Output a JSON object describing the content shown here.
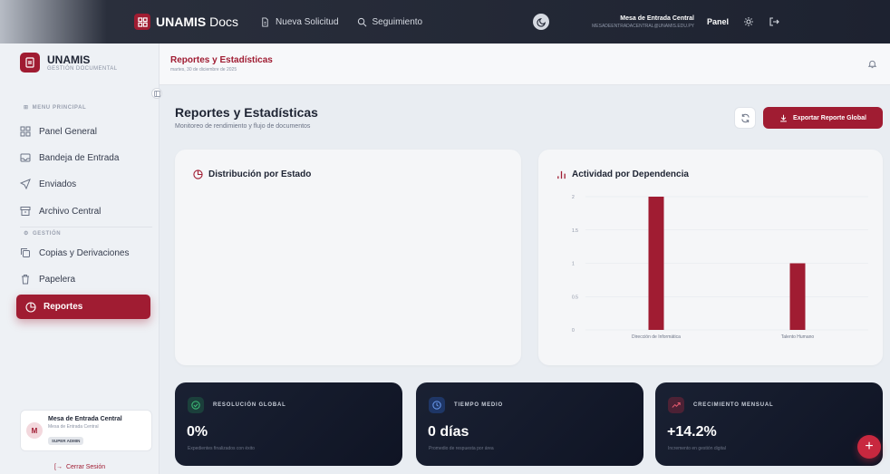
{
  "topbar": {
    "brand_prefix": "UNAMIS",
    "brand_suffix": " Docs",
    "nav": [
      {
        "label": "Nueva Solicitud",
        "icon": "file-icon"
      },
      {
        "label": "Seguimiento",
        "icon": "search-icon"
      }
    ],
    "user_name": "Mesa de Entrada Central",
    "user_email": "MESADEENTRADACENTRAL@UNAMIS.EDU.PY",
    "panel_label": "Panel"
  },
  "sidebar": {
    "brand_title": "UNAMIS",
    "brand_sub": "GESTIÓN DOCUMENTAL",
    "section_main": "MENU PRINCIPAL",
    "section_mgmt": "GESTIÓN",
    "items": [
      {
        "label": "Panel General",
        "icon": "grid-icon"
      },
      {
        "label": "Bandeja de Entrada",
        "icon": "inbox-icon"
      },
      {
        "label": "Enviados",
        "icon": "send-icon"
      },
      {
        "label": "Archivo Central",
        "icon": "archive-icon"
      },
      {
        "label": "Copias y Derivaciones",
        "icon": "copy-icon"
      },
      {
        "label": "Papelera",
        "icon": "trash-icon"
      },
      {
        "label": "Reportes",
        "icon": "pie-chart-icon",
        "active": true
      }
    ],
    "user": {
      "initial": "M",
      "name": "Mesa de Entrada Central",
      "role": "Mesa de Entrada Central",
      "badge": "SUPER ADMIN"
    },
    "logout": "Cerrar Sesión"
  },
  "header": {
    "title": "Reportes y Estadísticas",
    "date": "martes, 30 de diciembre de 2025"
  },
  "main": {
    "title": "Reportes y Estadísticas",
    "subtitle": "Monitoreo de rendimiento y flujo de documentos",
    "export_label": "Exportar Reporte Global",
    "status_card_title": "Distribución por Estado",
    "activity_card_title": "Actividad por Dependencia"
  },
  "chart_data": {
    "type": "bar",
    "title": "Actividad por Dependencia",
    "categories": [
      "Dirección de Informática",
      "Talento Humano"
    ],
    "values": [
      2,
      1
    ],
    "ylim": [
      0,
      2
    ],
    "yticks": [
      "0",
      "0.5",
      "1",
      "1.5",
      "2"
    ],
    "grid": true,
    "color": "#a01c32"
  },
  "stats": [
    {
      "label": "RESOLUCIÓN GLOBAL",
      "value": "0%",
      "desc": "Expedientes finalizados con éxito",
      "icon": "check-circle-icon",
      "color": "#22a05a"
    },
    {
      "label": "TIEMPO MEDIO",
      "value": "0 días",
      "desc": "Promedio de respuesta por área",
      "icon": "clock-icon",
      "color": "#2f6ee0"
    },
    {
      "label": "CRECIMIENTO MENSUAL",
      "value": "+14.2%",
      "desc": "Incremento en gestión digital",
      "icon": "trend-up-icon",
      "color": "#c8283f"
    }
  ]
}
